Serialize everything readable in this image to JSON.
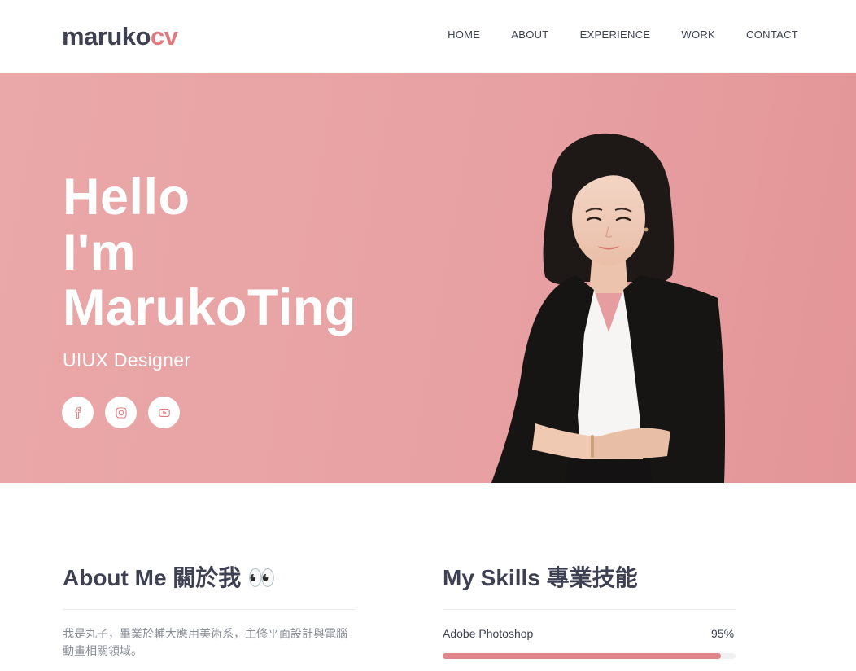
{
  "logo": {
    "part1": "maruko",
    "part2": "cv"
  },
  "nav": [
    {
      "label": "HOME"
    },
    {
      "label": "ABOUT"
    },
    {
      "label": "EXPERIENCE"
    },
    {
      "label": "WORK"
    },
    {
      "label": "CONTACT"
    }
  ],
  "hero": {
    "line1": "Hello",
    "line2": "I'm",
    "line3": "MarukoTing",
    "subtitle": "UIUX Designer",
    "socials": [
      {
        "icon": "facebook-icon"
      },
      {
        "icon": "instagram-icon"
      },
      {
        "icon": "youtube-icon"
      }
    ]
  },
  "about": {
    "title": "About Me 關於我 👀",
    "text": "我是丸子，畢業於輔大應用美術系，主修平面設計與電腦動畫相關領域。"
  },
  "skills": {
    "title": "My Skills 專業技能",
    "items": [
      {
        "name": "Adobe Photoshop",
        "percent_label": "95%",
        "level": 0.95
      }
    ]
  },
  "colors": {
    "accent": "#e0797c",
    "hero_bg": "#e8a1a3",
    "text_dark": "#3d4152",
    "skill_bar": "#e0868a"
  }
}
